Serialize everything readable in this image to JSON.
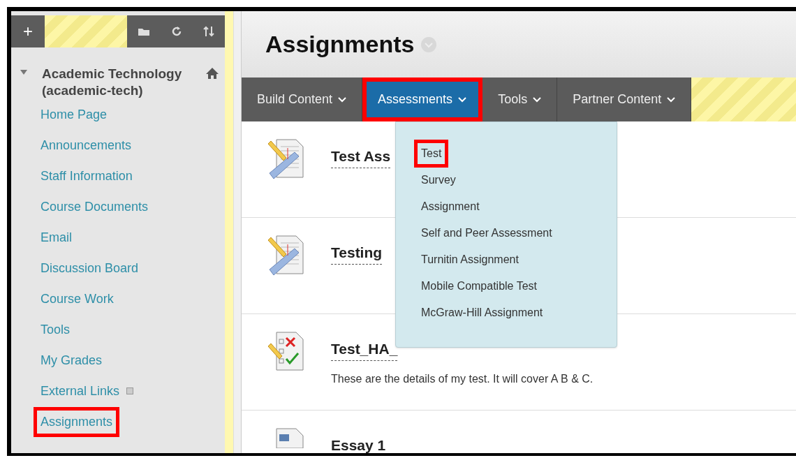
{
  "sidebar": {
    "toolbar": {
      "add_label": "+"
    },
    "course": {
      "title": "Academic Technology (academic-tech)",
      "expanded": true
    },
    "items": [
      {
        "label": "Home Page",
        "kind": "link",
        "highlighted": false
      },
      {
        "label": "Announcements",
        "kind": "link",
        "highlighted": false
      },
      {
        "label": "Staff Information",
        "kind": "link",
        "highlighted": false
      },
      {
        "label": "Course Documents",
        "kind": "link",
        "highlighted": false
      },
      {
        "label": "Email",
        "kind": "link",
        "highlighted": false
      },
      {
        "label": "Discussion Board",
        "kind": "link",
        "highlighted": false
      },
      {
        "label": "Course Work",
        "kind": "link",
        "highlighted": false
      },
      {
        "label": "Tools",
        "kind": "link",
        "highlighted": false
      },
      {
        "label": "My Grades",
        "kind": "link",
        "highlighted": false
      },
      {
        "label": "External Links",
        "kind": "external",
        "highlighted": false
      },
      {
        "label": "Assignments",
        "kind": "link",
        "highlighted": true
      }
    ]
  },
  "page": {
    "title": "Assignments"
  },
  "nav": [
    {
      "label": "Build Content",
      "selected": false,
      "highlighted": false
    },
    {
      "label": "Assessments",
      "selected": true,
      "highlighted": true
    },
    {
      "label": "Tools",
      "selected": false,
      "highlighted": false
    },
    {
      "label": "Partner Content",
      "selected": false,
      "highlighted": false
    }
  ],
  "menu": [
    {
      "label": "Test",
      "highlighted": true
    },
    {
      "label": "Survey",
      "highlighted": false
    },
    {
      "label": "Assignment",
      "highlighted": false
    },
    {
      "label": "Self and Peer Assessment",
      "highlighted": false
    },
    {
      "label": "Turnitin Assignment",
      "highlighted": false
    },
    {
      "label": "Mobile Compatible Test",
      "highlighted": false
    },
    {
      "label": "McGraw-Hill Assignment",
      "highlighted": false
    }
  ],
  "content": [
    {
      "title": "Test Ass",
      "kind": "test"
    },
    {
      "title": "Testing",
      "kind": "test"
    },
    {
      "title": "Test_HA_",
      "kind": "quiz",
      "description": "These are the details of my test. It will cover A B & C."
    },
    {
      "title": "Essay 1",
      "kind": "essay"
    }
  ]
}
